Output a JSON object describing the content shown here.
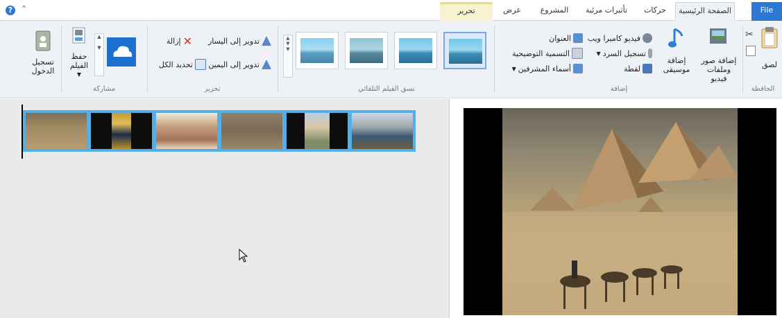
{
  "tabs": [
    {
      "label": "File"
    },
    {
      "label": "الصفحة الرئيسية"
    },
    {
      "label": "حركات"
    },
    {
      "label": "تأثيرات مرئية"
    },
    {
      "label": "المشروع"
    },
    {
      "label": "عرض"
    },
    {
      "label": "تحرير"
    }
  ],
  "ribbon": {
    "clipboard": {
      "group_label": "الحافظة",
      "paste_label": "لصق"
    },
    "add": {
      "group_label": "إضافة",
      "add_photos_videos_label": "إضافة صور وملفات فيديو",
      "add_music_label": "إضافة موسيقى",
      "webcam_video_label": "فيديو كاميرا ويب",
      "record_narration_label": "تسجيل السرد",
      "snapshot_label": "لقطة",
      "title_label": "العنوان",
      "caption_label": "التسمية التوضيحية",
      "credits_label": "أسماء المشرفين"
    },
    "automovie": {
      "group_label": "نسق الفيلم التلقائي"
    },
    "edit": {
      "group_label": "تحرير",
      "rotate_left_label": "تدوير إلى اليسار",
      "rotate_right_label": "تدوير إلى اليمين",
      "remove_label": "إزالة",
      "select_all_label": "تحديد الكل"
    },
    "share": {
      "group_label": "مشاركة",
      "save_movie_label": "حفظ الفيلم"
    },
    "sign_in_label": "تسجيل الدخول"
  },
  "colors": {
    "accent": "#2b79d3",
    "ribbon_bg": "#eef2f7",
    "context_tab": "#f7f3cf",
    "clip_border": "#54aee8",
    "storyboard_bg": "#eaeaea"
  }
}
